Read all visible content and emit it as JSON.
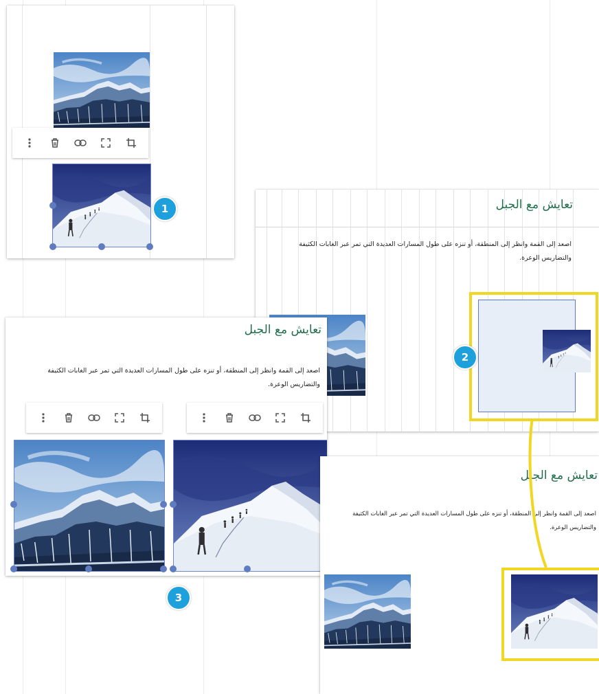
{
  "heading": "تعايش مع الجبل",
  "paragraph_line1": "اصعد إلى القمة وانظر إلى المنطقة، أو تنزه على طول المسارات العديدة التي تمر عبر الغابات الكثيفة",
  "paragraph_line2": "والتضاريس الوعرة.",
  "toolbar_icons": [
    "more-vert-icon",
    "delete-icon",
    "link-icon",
    "fullscreen-icon",
    "crop-icon"
  ],
  "steps": {
    "one": "1",
    "two": "2",
    "three": "3"
  },
  "images": {
    "forest": "mountain-forest-image",
    "climbers": "snow-climbers-image"
  },
  "colors": {
    "title": "#1f6f4b",
    "handle": "#5f7cc0",
    "badge": "#1ea0dc",
    "highlight": "#f2d624",
    "drop_zone": "#e8eef8"
  }
}
